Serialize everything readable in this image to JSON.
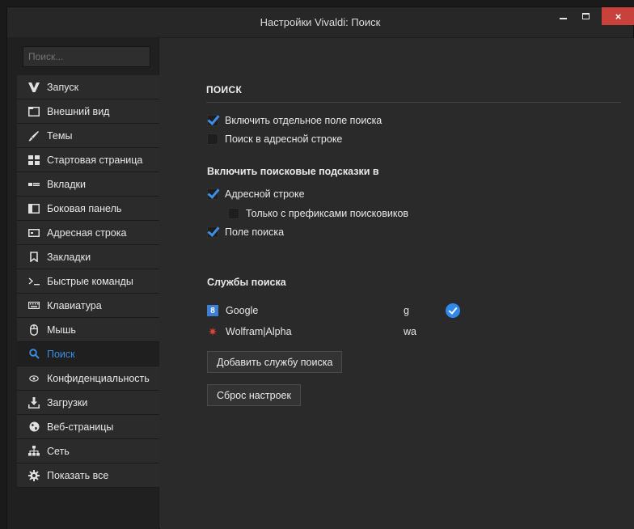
{
  "window": {
    "title": "Настройки Vivaldi: Поиск",
    "close_glyph": "×"
  },
  "sidebar": {
    "search_placeholder": "Поиск...",
    "items": [
      {
        "label": "Запуск",
        "icon": "vivaldi-logo-icon"
      },
      {
        "label": "Внешний вид",
        "icon": "window-icon"
      },
      {
        "label": "Темы",
        "icon": "brush-icon"
      },
      {
        "label": "Стартовая страница",
        "icon": "grid-icon"
      },
      {
        "label": "Вкладки",
        "icon": "tabs-icon"
      },
      {
        "label": "Боковая панель",
        "icon": "panel-icon"
      },
      {
        "label": "Адресная строка",
        "icon": "address-bar-icon"
      },
      {
        "label": "Закладки",
        "icon": "bookmark-icon"
      },
      {
        "label": "Быстрые команды",
        "icon": "command-prompt-icon"
      },
      {
        "label": "Клавиатура",
        "icon": "keyboard-icon"
      },
      {
        "label": "Мышь",
        "icon": "mouse-icon"
      },
      {
        "label": "Поиск",
        "icon": "search-icon",
        "active": true
      },
      {
        "label": "Конфиденциальность",
        "icon": "eye-icon"
      },
      {
        "label": "Загрузки",
        "icon": "download-icon"
      },
      {
        "label": "Веб-страницы",
        "icon": "globe-icon"
      },
      {
        "label": "Сеть",
        "icon": "network-icon"
      },
      {
        "label": "Показать все",
        "icon": "gear-icon"
      }
    ]
  },
  "search_section": {
    "title": "ПОИСК",
    "options": [
      {
        "label": "Включить отдельное поле поиска",
        "checked": true
      },
      {
        "label": "Поиск в адресной строке",
        "checked": false
      }
    ],
    "suggestions_heading": "Включить поисковые подсказки в",
    "suggestions": [
      {
        "label": "Адресной строке",
        "checked": true
      },
      {
        "label": "Только с префиксами поисковиков",
        "checked": false
      },
      {
        "label": "Поле поиска",
        "checked": true
      }
    ],
    "services_heading": "Службы поиска",
    "engines": [
      {
        "name": "Google",
        "key": "g",
        "default": true,
        "icon_glyph": "8"
      },
      {
        "name": "Wolfram|Alpha",
        "key": "wa",
        "default": false,
        "icon_glyph": "✷"
      }
    ],
    "add_button": "Добавить службу поиска",
    "reset_button": "Сброс настроек"
  },
  "colors": {
    "accent": "#3c8fe6",
    "close_button": "#c9413b",
    "background": "#2a2a2a",
    "sidebar": "#202020"
  }
}
